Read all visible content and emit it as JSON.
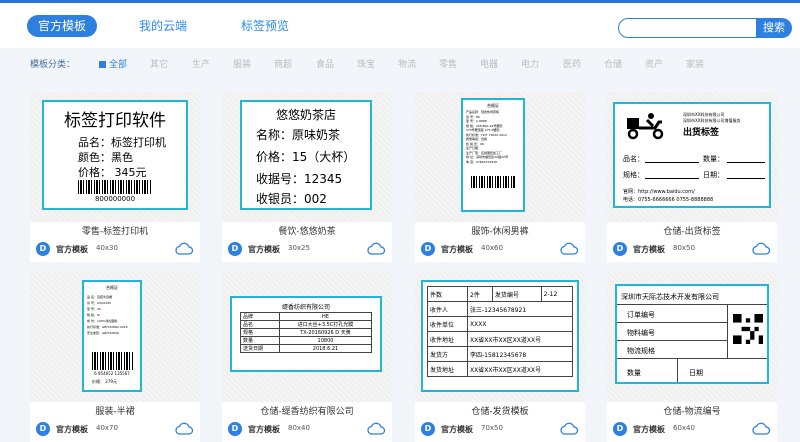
{
  "header": {
    "tabs": [
      {
        "label": "官方模板",
        "active": true
      },
      {
        "label": "我的云端",
        "active": false
      },
      {
        "label": "标签预览",
        "active": false
      }
    ],
    "search": {
      "placeholder": "",
      "button": "搜索"
    }
  },
  "categories": {
    "label": "模板分类：",
    "items": [
      "全部",
      "其它",
      "生产",
      "服装",
      "商超",
      "食品",
      "珠宝",
      "物流",
      "零售",
      "电器",
      "电力",
      "医药",
      "仓储",
      "资产",
      "家装"
    ],
    "active": "全部"
  },
  "templates": [
    {
      "title": "零售-标签打印机",
      "source": "官方模板",
      "size": "40x30"
    },
    {
      "title": "餐饮-悠悠奶茶",
      "source": "官方模板",
      "size": "30x25"
    },
    {
      "title": "服饰-休闲男裤",
      "source": "官方模板",
      "size": "40x60"
    },
    {
      "title": "仓储-出货标签",
      "source": "官方模板",
      "size": "80x50"
    },
    {
      "title": "服装-半裙",
      "source": "官方模板",
      "size": "40x70"
    },
    {
      "title": "仓储-缇香纺织有限公司",
      "source": "官方模板",
      "size": "80x40"
    },
    {
      "title": "仓储-发货模板",
      "source": "官方模板",
      "size": "70x50"
    },
    {
      "title": "仓储-物流编号",
      "source": "官方模板",
      "size": "60x40"
    }
  ],
  "previews": {
    "p1": {
      "title": "标签打印软件",
      "l1": "品名：标签打印机",
      "l2": "颜色：黑色",
      "l3": "价格：  345元",
      "code": "800000000"
    },
    "p2": {
      "title": "悠悠奶茶店",
      "l1": "名称：原味奶茶",
      "l2": "价格：15（大杯）",
      "l3": "收据号：12345",
      "l4": "收银员：002"
    },
    "p3": {
      "title": "合格证",
      "lines": [
        "产品名称：轻奢休闲男裤",
        "货    号：8K",
        "型    号：C-6868",
        "规    格：165/80A 29号腰围",
        "         175号腰围度 175-5腰围",
        "执行标准：FZ/T 73020-2012",
        "质量等级：合格",
        "检 验 员：06",
        "生产日期：",
        "生产厂家：名扬服装加工厂",
        "地    址：深圳市福田区XX路XX号",
        "电    话：07660725818"
      ]
    },
    "p4": {
      "company": "深圳市XX科技有限公司",
      "sub": "深圳市XX科技有限公司增值服务",
      "title": "出货标签",
      "f1": "品名：",
      "f2": "数量：",
      "f3": "规格：",
      "f4": "日期：",
      "web": "官网：http://www.baidu.com/",
      "tel": "电话：0755-6666666  0755-8888888"
    },
    "p5": {
      "title": "合格证",
      "lines": [
        "品  名：百搭半身裙",
        "货  号：XXXX495",
        "型  号：X5",
        "规  格：M",
        "成  份：100%涤纶面料",
        "执行标准：GB/T22862-2016",
        "安全类别：GB/T22849"
      ],
      "code": "6 954652 135567",
      "price": "价格：  279元"
    },
    "p6": {
      "company": "缇香纺织有限公司",
      "rows": [
        [
          "品牌",
          "HE"
        ],
        [
          "品名",
          "进口大丝+3.5C打孔光膜"
        ],
        [
          "规格",
          "TX-20160926  D  天黄"
        ],
        [
          "数量",
          "10800"
        ],
        [
          "送货日期",
          "2018.6.21"
        ]
      ]
    },
    "p7": {
      "h1": "件数",
      "h2": "2件",
      "h3": "发货编号",
      "h4": "2-12",
      "rows": [
        [
          "收件人",
          "张三-12345678921"
        ],
        [
          "收件单位",
          "XXXX"
        ],
        [
          "收件地址",
          "XX省XX市XX区XX道XX号"
        ],
        [
          "发货方",
          "李四-15812345678"
        ],
        [
          "发货地址",
          "XX省XX市XX区XX道XX号"
        ]
      ]
    },
    "p8": {
      "company": "深圳市天际芯技术开发有限公司",
      "rows": [
        "订单编号",
        "物料编号",
        "物流规格"
      ],
      "f1": "数量",
      "f2": "日期"
    }
  },
  "colors": {
    "accent": "#2d7fe0",
    "label_border": "#22b6d6"
  }
}
